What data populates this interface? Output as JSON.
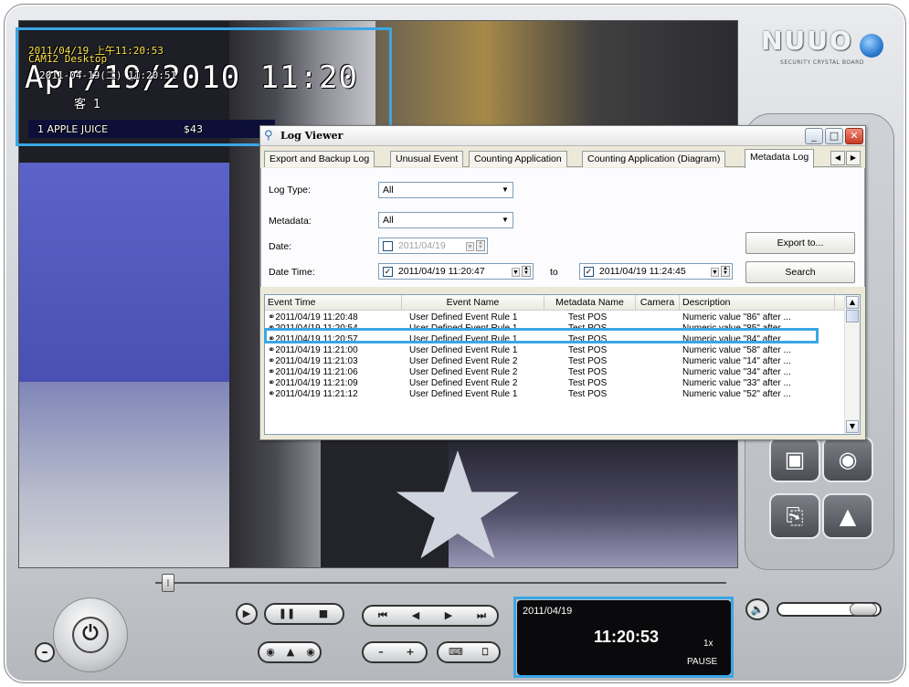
{
  "osd": {
    "timestamp": "2011/04/19 上午11:20:53",
    "camera_name": "CAM12 Desktop",
    "big_date": "Apr/19/2010 11:20",
    "small_time": "2011-04-19(二) 11:20:51",
    "customer": "客 1",
    "item_name": "1 APPLE JUICE",
    "item_price": "$43"
  },
  "logo": {
    "brand": "NUUO",
    "tagline": "SECURITY CRYSTAL BOARD"
  },
  "log_viewer": {
    "title": "Log Viewer",
    "tabs": [
      {
        "label": "Export and Backup Log"
      },
      {
        "label": "Unusual Event"
      },
      {
        "label": "Counting Application"
      },
      {
        "label": "Counting Application (Diagram)"
      },
      {
        "label": "Metadata Log"
      }
    ],
    "form": {
      "log_type_label": "Log Type:",
      "log_type_value": "All",
      "metadata_label": "Metadata:",
      "metadata_value": "All",
      "date_label": "Date:",
      "date_value": "2011/04/19",
      "datetime_label": "Date Time:",
      "datetime_from": "2011/04/19 11:20:47",
      "to_label": "to",
      "datetime_to": "2011/04/19 11:24:45",
      "export_button": "Export to...",
      "search_button": "Search"
    },
    "columns": [
      "Event Time",
      "Event Name",
      "Metadata Name",
      "Camera",
      "Description"
    ],
    "rows": [
      {
        "time": "2011/04/19 11:20:48",
        "event": "User Defined Event Rule 1",
        "metadata": "Test POS",
        "camera": "",
        "description": "Numeric value \"86\" after ..."
      },
      {
        "time": "2011/04/19 11:20:54",
        "event": "User Defined Event Rule 1",
        "metadata": "Test POS",
        "camera": "",
        "description": "Numeric value \"85\" after ..."
      },
      {
        "time": "2011/04/19 11:20:57",
        "event": "User Defined Event Rule 1",
        "metadata": "Test POS",
        "camera": "",
        "description": "Numeric value \"84\" after ..."
      },
      {
        "time": "2011/04/19 11:21:00",
        "event": "User Defined Event Rule 1",
        "metadata": "Test POS",
        "camera": "",
        "description": "Numeric value \"58\" after ..."
      },
      {
        "time": "2011/04/19 11:21:03",
        "event": "User Defined Event Rule 2",
        "metadata": "Test POS",
        "camera": "",
        "description": "Numeric value \"14\" after ..."
      },
      {
        "time": "2011/04/19 11:21:06",
        "event": "User Defined Event Rule 2",
        "metadata": "Test POS",
        "camera": "",
        "description": "Numeric value \"34\" after ..."
      },
      {
        "time": "2011/04/19 11:21:09",
        "event": "User Defined Event Rule 2",
        "metadata": "Test POS",
        "camera": "",
        "description": "Numeric value \"33\" after ..."
      },
      {
        "time": "2011/04/19 11:21:12",
        "event": "User Defined Event Rule 1",
        "metadata": "Test POS",
        "camera": "",
        "description": "Numeric value \"52\" after ..."
      }
    ]
  },
  "status": {
    "date": "2011/04/19",
    "time": "11:20:53",
    "speed": "1x",
    "mode": "PAUSE"
  },
  "colors": {
    "highlight": "#3aa6e6",
    "osd_text": "#ffe44a"
  }
}
